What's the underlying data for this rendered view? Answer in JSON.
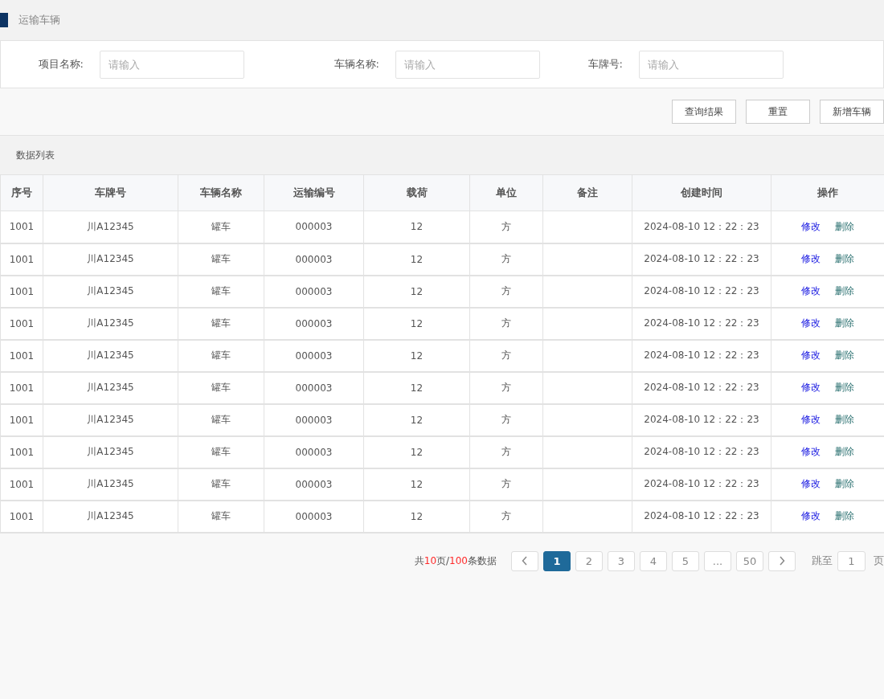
{
  "page_title": "运输车辆",
  "filters": [
    {
      "label": "项目名称:",
      "placeholder": "请输入"
    },
    {
      "label": "车辆名称:",
      "placeholder": "请输入"
    },
    {
      "label": "车牌号:",
      "placeholder": "请输入"
    }
  ],
  "buttons": [
    "查询结果",
    "重置",
    "新增车辆"
  ],
  "list_title": "数据列表",
  "table": {
    "columns": [
      "序号",
      "车牌号",
      "车辆名称",
      "运输编号",
      "载荷",
      "单位",
      "备注",
      "创建时间",
      "操作"
    ],
    "rows": [
      {
        "cells": [
          "1001",
          "川A12345",
          "罐车",
          "000003",
          "12",
          "方",
          "",
          "2024-08-10 12：22：23"
        ],
        "actions": [
          "修改",
          "删除"
        ]
      },
      {
        "cells": [
          "1001",
          "川A12345",
          "罐车",
          "000003",
          "12",
          "方",
          "",
          "2024-08-10 12：22：23"
        ],
        "actions": [
          "修改",
          "删除"
        ]
      },
      {
        "cells": [
          "1001",
          "川A12345",
          "罐车",
          "000003",
          "12",
          "方",
          "",
          "2024-08-10 12：22：23"
        ],
        "actions": [
          "修改",
          "删除"
        ]
      },
      {
        "cells": [
          "1001",
          "川A12345",
          "罐车",
          "000003",
          "12",
          "方",
          "",
          "2024-08-10 12：22：23"
        ],
        "actions": [
          "修改",
          "删除"
        ]
      },
      {
        "cells": [
          "1001",
          "川A12345",
          "罐车",
          "000003",
          "12",
          "方",
          "",
          "2024-08-10 12：22：23"
        ],
        "actions": [
          "修改",
          "删除"
        ]
      },
      {
        "cells": [
          "1001",
          "川A12345",
          "罐车",
          "000003",
          "12",
          "方",
          "",
          "2024-08-10 12：22：23"
        ],
        "actions": [
          "修改",
          "删除"
        ]
      },
      {
        "cells": [
          "1001",
          "川A12345",
          "罐车",
          "000003",
          "12",
          "方",
          "",
          "2024-08-10 12：22：23"
        ],
        "actions": [
          "修改",
          "删除"
        ]
      },
      {
        "cells": [
          "1001",
          "川A12345",
          "罐车",
          "000003",
          "12",
          "方",
          "",
          "2024-08-10 12：22：23"
        ],
        "actions": [
          "修改",
          "删除"
        ]
      },
      {
        "cells": [
          "1001",
          "川A12345",
          "罐车",
          "000003",
          "12",
          "方",
          "",
          "2024-08-10 12：22：23"
        ],
        "actions": [
          "修改",
          "删除"
        ]
      },
      {
        "cells": [
          "1001",
          "川A12345",
          "罐车",
          "000003",
          "12",
          "方",
          "",
          "2024-08-10 12：22：23"
        ],
        "actions": [
          "修改",
          "删除"
        ]
      }
    ]
  },
  "pagination": {
    "summary": [
      {
        "text": "共",
        "highlight": false
      },
      {
        "text": "10",
        "highlight": true
      },
      {
        "text": "页/",
        "highlight": false
      },
      {
        "text": "100",
        "highlight": true
      },
      {
        "text": "条数据",
        "highlight": false
      }
    ],
    "pages": [
      {
        "label": "1",
        "selected": true
      },
      {
        "label": "2",
        "selected": false
      },
      {
        "label": "3",
        "selected": false
      },
      {
        "label": "4",
        "selected": false
      },
      {
        "label": "5",
        "selected": false
      },
      {
        "label": "...",
        "selected": false
      },
      {
        "label": "50",
        "selected": false
      }
    ],
    "jump_label": "跳至",
    "jump_value": "1",
    "jump_suffix": "页"
  }
}
